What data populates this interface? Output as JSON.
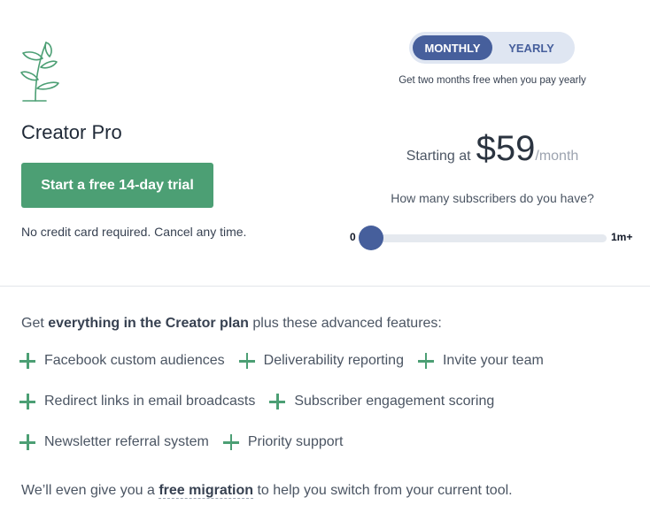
{
  "plan": {
    "name": "Creator Pro",
    "trial_button": "Start a free 14-day trial",
    "no_card_note": "No credit card required. Cancel any time."
  },
  "billing": {
    "monthly_label": "MONTHLY",
    "yearly_label": "YEARLY",
    "selected": "MONTHLY",
    "promo": "Get two months free when you pay yearly"
  },
  "pricing": {
    "starting_label": "Starting at",
    "amount": "$59",
    "period": "/month"
  },
  "subscribers": {
    "question": "How many subscribers do you have?",
    "min_label": "0",
    "max_label": "1m+",
    "value_fraction": 0
  },
  "features": {
    "intro_prefix": "Get ",
    "intro_bold": "everything in the Creator plan",
    "intro_suffix": " plus these advanced features:",
    "rows": [
      [
        "Facebook custom audiences",
        "Deliverability reporting",
        "Invite your team"
      ],
      [
        "Redirect links in email broadcasts",
        "Subscriber engagement scoring"
      ],
      [
        "Newsletter referral system",
        "Priority support"
      ]
    ]
  },
  "migration": {
    "prefix": "We’ll even give you a ",
    "link": "free migration",
    "suffix": " to help you switch from your current tool."
  },
  "colors": {
    "accent_green": "#4c9f74",
    "accent_blue": "#465f9c",
    "toggle_bg": "#dfe6f2"
  },
  "icons": {
    "logo": "plant-sprout-icon",
    "feature": "plus-icon"
  }
}
